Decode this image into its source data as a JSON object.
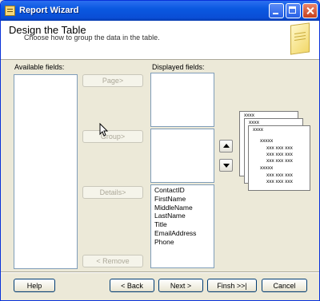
{
  "window": {
    "title": "Report Wizard"
  },
  "header": {
    "title": "Design the Table",
    "subtitle": "Choose how to group the data in the table."
  },
  "available": {
    "label": "Available fields:",
    "items": []
  },
  "displayed": {
    "label": "Displayed fields:",
    "items": [
      "ContactID",
      "FirstName",
      "MiddleName",
      "LastName",
      "Title",
      "EmailAddress",
      "Phone"
    ]
  },
  "buttons": {
    "page": "Page>",
    "group": "Group>",
    "details": "Details>",
    "remove": "< Remove"
  },
  "preview": {
    "row1": "xxxx",
    "row2": "xxxx",
    "row3": "xxxx",
    "detail_head": "xxxxx",
    "detail_line": "xxx xxx xxx",
    "detail_head2": "xxxxx"
  },
  "footer": {
    "help": "Help",
    "back": "< Back",
    "next": "Next >",
    "finish": "Finsh >>|",
    "cancel": "Cancel"
  }
}
